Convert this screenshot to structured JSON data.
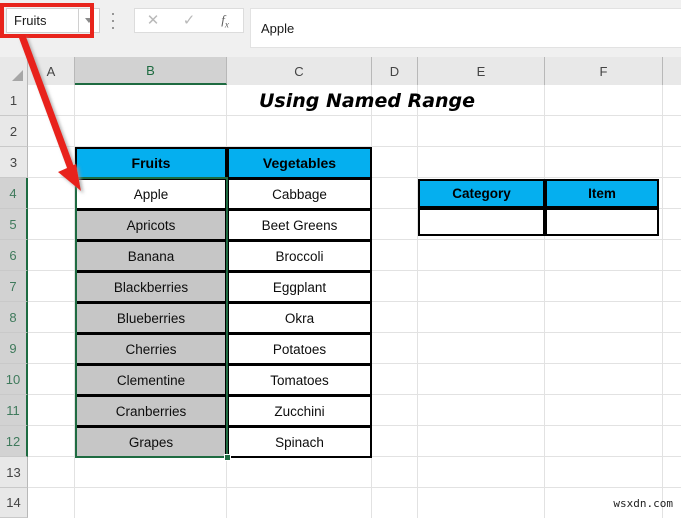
{
  "formula_bar": {
    "name_box_value": "Fruits",
    "name_box_dropdown_icon": "chevron-down-icon",
    "overflow_icon": "vertical-dots-icon",
    "cancel_icon": "✕",
    "confirm_icon": "✓",
    "function_icon": "fx",
    "formula_value": "Apple",
    "formula_placeholder": ""
  },
  "grid": {
    "column_headers": [
      "A",
      "B",
      "C",
      "D",
      "E",
      "F"
    ],
    "selected_column": "B",
    "row_headers": [
      "1",
      "2",
      "3",
      "4",
      "5",
      "6",
      "7",
      "8",
      "9",
      "10",
      "11",
      "12",
      "13",
      "14"
    ],
    "selected_rows": [
      "4",
      "5",
      "6",
      "7",
      "8",
      "9",
      "10",
      "11",
      "12"
    ]
  },
  "sheet": {
    "title": "Using Named Range",
    "fruits_table": {
      "headers": [
        "Fruits",
        "Vegetables"
      ],
      "rows": [
        [
          "Apple",
          "Cabbage"
        ],
        [
          "Apricots",
          "Beet Greens"
        ],
        [
          "Banana",
          "Broccoli"
        ],
        [
          "Blackberries",
          "Eggplant"
        ],
        [
          "Blueberries",
          "Okra"
        ],
        [
          "Cherries",
          "Potatoes"
        ],
        [
          "Clementine",
          "Tomatoes"
        ],
        [
          "Cranberries",
          "Zucchini"
        ],
        [
          "Grapes",
          "Spinach"
        ]
      ]
    },
    "lookup_table": {
      "headers": [
        "Category",
        "Item"
      ],
      "rows": [
        [
          "",
          ""
        ]
      ]
    }
  },
  "annotation": {
    "arrow_color": "#e8241c",
    "highlight_color": "#e8241c"
  },
  "colors": {
    "header_cyan": "#05AFEF",
    "selection_gray": "#C6C6C6",
    "excel_green": "#1e6b41"
  },
  "watermark": {
    "text": "wsxdn.com"
  }
}
